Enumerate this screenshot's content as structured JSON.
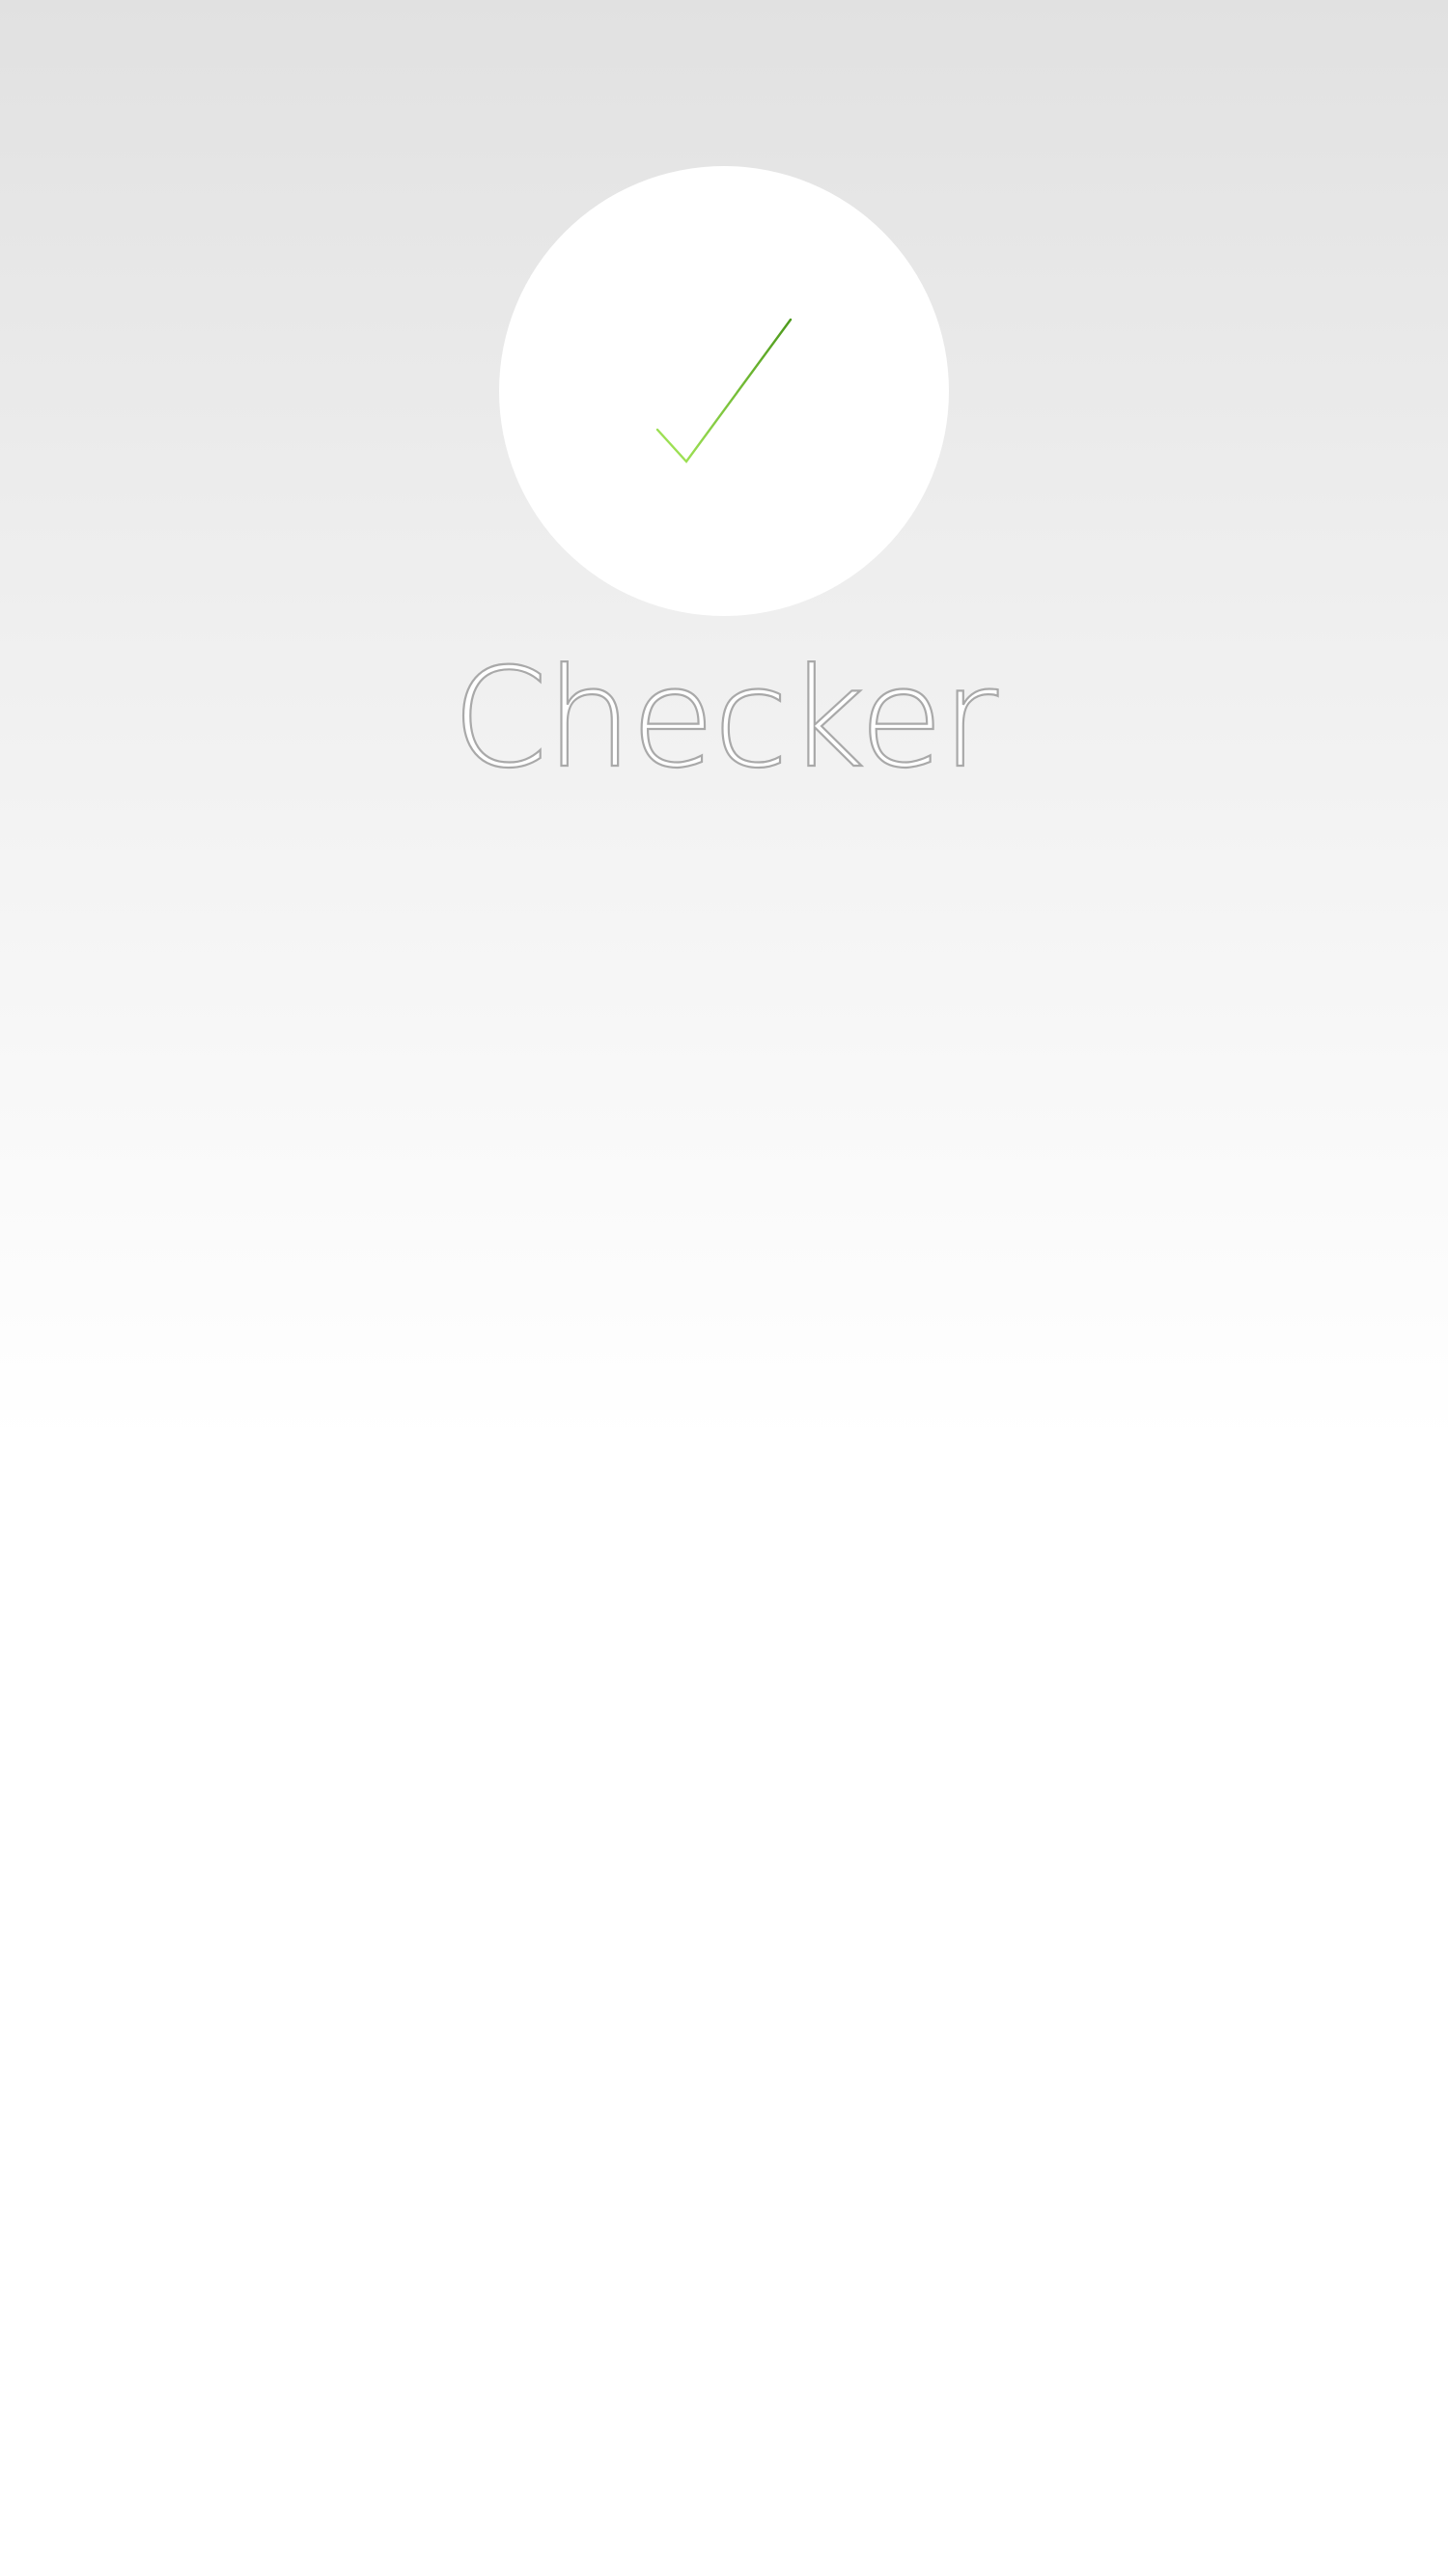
{
  "app": {
    "title": "Checker"
  },
  "logo": {
    "icon": "checkmark-icon",
    "circle_color": "#ffffff",
    "check_color_light": "#a6e85a",
    "check_color_dark": "#4d9a1c"
  },
  "colors": {
    "background_top": "#e1e1e1",
    "background_bottom": "#ffffff",
    "title_outline": "#a9a9a9"
  }
}
